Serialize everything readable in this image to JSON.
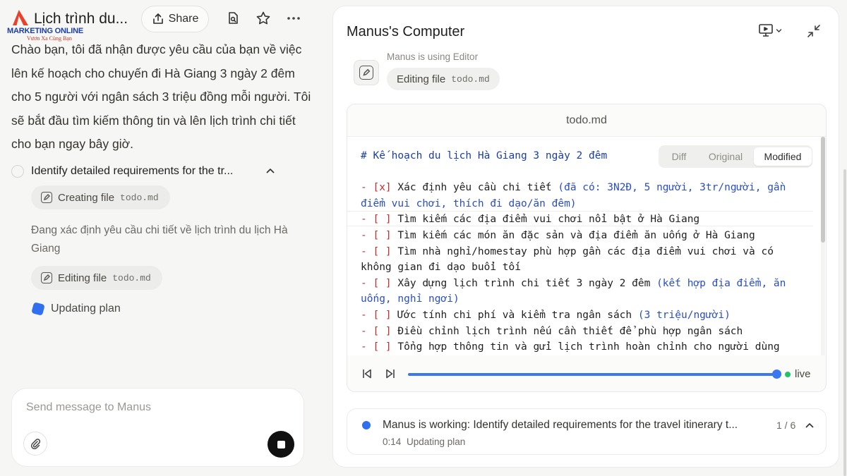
{
  "header": {
    "logo_brand": "MARKETING ONLINE",
    "logo_slogan": "Vươn Xa Cùng Bạn",
    "title": "Lịch trình du...",
    "share_label": "Share"
  },
  "chat": {
    "intro": "Chào bạn, tôi đã nhận được yêu cầu của bạn về việc lên kế hoạch cho chuyến đi Hà Giang 3 ngày 2 đêm cho 5 người với ngân sách 3 triệu đồng mỗi người. Tôi sẽ bắt đầu tìm kiếm thông tin và lên lịch trình chi tiết cho bạn ngay bây giờ.",
    "step_title": "Identify detailed requirements for the tr...",
    "chip1_label": "Creating file",
    "chip1_file": "todo.md",
    "step_detail": "Đang xác định yêu cầu chi tiết về lịch trình du lịch Hà Giang",
    "chip2_label": "Editing file",
    "chip2_file": "todo.md",
    "updating_label": "Updating plan"
  },
  "composer": {
    "placeholder": "Send message to Manus"
  },
  "computer": {
    "title": "Manus's Computer",
    "using_text": "Manus is using Editor",
    "chip_label": "Editing file",
    "chip_file": "todo.md",
    "file_name": "todo.md",
    "view_modes": [
      "Diff",
      "Original",
      "Modified"
    ],
    "active_view": "Modified",
    "live_label": "live",
    "progress_fraction": 1.0,
    "code": {
      "heading": "# Kế hoạch du lịch Hà Giang 3 ngày 2 đêm",
      "lines": [
        {
          "mark": "[x]",
          "parts": [
            "Xác định yêu cầu chi tiết ",
            "(đã có: 3N2Đ, 5 người, 3tr/người, gần\nđiểm vui chơi, thích đi dạo/ăn đêm)"
          ]
        },
        {
          "mark": "[ ]",
          "text": "Tìm kiếm các địa điểm vui chơi nổi bật ở Hà Giang"
        },
        {
          "mark": "[ ]",
          "text": "Tìm kiếm các món ăn đặc sản và địa điểm ăn uống ở Hà Giang"
        },
        {
          "mark": "[ ]",
          "text": "Tìm nhà nghỉ/homestay phù hợp gần các địa điểm vui chơi và có\nkhông gian đi dạo buổi tối"
        },
        {
          "mark": "[ ]",
          "parts": [
            "Xây dựng lịch trình chi tiết 3 ngày 2 đêm ",
            "(kết hợp địa điểm, ăn\nuống, nghỉ ngơi)"
          ]
        },
        {
          "mark": "[ ]",
          "parts": [
            "Ước tính chi phí và kiểm tra ngân sách ",
            "(3 triệu/người)"
          ]
        },
        {
          "mark": "[ ]",
          "text": "Điều chỉnh lịch trình nếu cần thiết để phù hợp ngân sách"
        },
        {
          "mark": "[ ]",
          "text": "Tổng hợp thông tin và gửi lịch trình hoàn chỉnh cho người dùng"
        }
      ]
    }
  },
  "status": {
    "message": "Manus is working: Identify detailed requirements for the travel itinerary t...",
    "time": "0:14",
    "sub": "Updating plan",
    "count": "1 / 6"
  },
  "colors": {
    "accent_blue": "#2f6ff0",
    "live_green": "#1ec46a",
    "checkbox_red": "#c42d2d",
    "heading_blue": "#1a3ea8"
  }
}
